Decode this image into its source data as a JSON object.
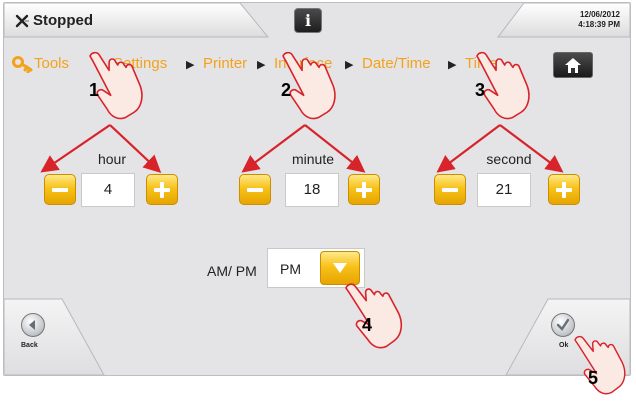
{
  "status": {
    "text": "Stopped",
    "icon": "close-x-icon"
  },
  "info": {
    "label": "i"
  },
  "datetime": {
    "date": "12/06/2012",
    "time": "4:18:39 PM"
  },
  "breadcrumb": [
    "Tools",
    "Settings",
    "Printer",
    "Interface",
    "Date/Time",
    "Time"
  ],
  "steppers": [
    {
      "label": "hour",
      "value": "4"
    },
    {
      "label": "minute",
      "value": "18"
    },
    {
      "label": "second",
      "value": "21"
    }
  ],
  "ampm": {
    "label": "AM/ PM",
    "value": "PM"
  },
  "back": {
    "label": "Back"
  },
  "ok": {
    "label": "Ok"
  },
  "callouts": [
    "1",
    "2",
    "3",
    "4",
    "5"
  ],
  "colors": {
    "accent": "#f3a21c",
    "arrow": "#d8232a",
    "button": "#f7c21a"
  }
}
